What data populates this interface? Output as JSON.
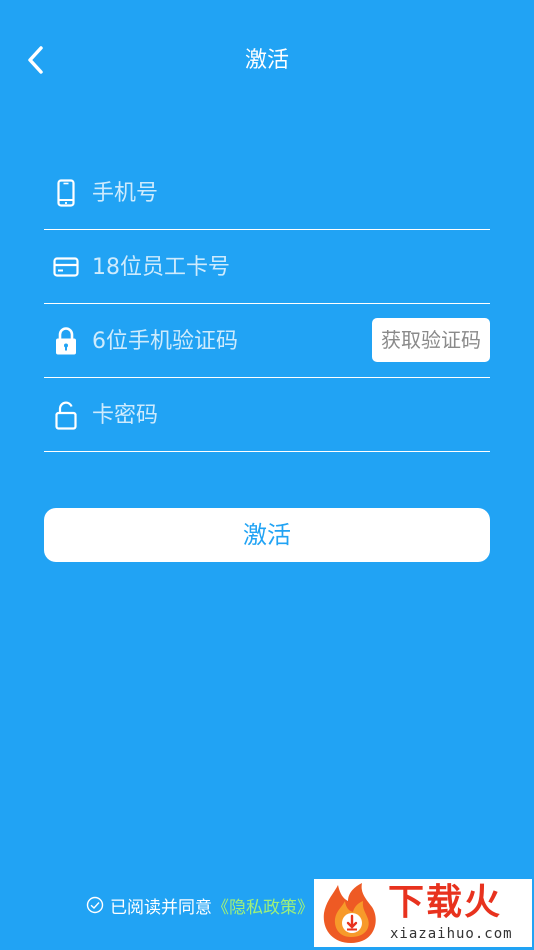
{
  "header": {
    "title": "激活",
    "back_icon": "chevron-left-icon"
  },
  "form": {
    "phone": {
      "placeholder": "手机号",
      "icon": "mobile-phone-icon"
    },
    "card_number": {
      "placeholder": "18位员工卡号",
      "icon": "card-icon"
    },
    "sms_code": {
      "placeholder": "6位手机验证码",
      "icon": "lock-closed-icon",
      "button_label": "获取验证码"
    },
    "card_password": {
      "placeholder": "卡密码",
      "icon": "lock-open-icon"
    }
  },
  "activate_button": {
    "label": "激活"
  },
  "agreement": {
    "text": "已阅读并同意",
    "policy_link": "《隐私政策》"
  },
  "watermark": {
    "title": "下载火",
    "url": "xiazaihuo.com"
  },
  "colors": {
    "background": "#21a3f4",
    "button_text": "#21a3f4",
    "policy_link": "#9ef07a",
    "code_button_text": "#8a8a8a"
  }
}
